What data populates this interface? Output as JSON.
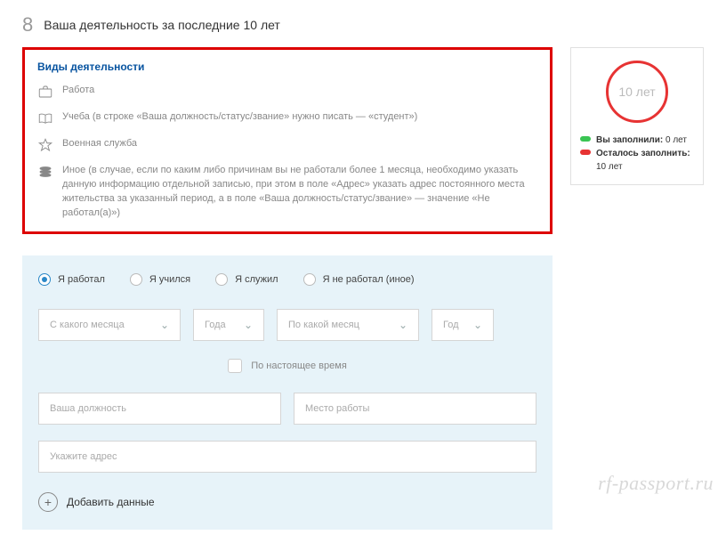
{
  "header": {
    "step": "8",
    "title": "Ваша деятельность за последние 10 лет"
  },
  "types": {
    "title": "Виды деятельности",
    "work": "Работа",
    "study": "Учеба (в строке «Ваша должность/статус/звание» нужно писать — «студент»)",
    "military": "Военная служба",
    "other": "Иное (в случае, если по каким либо причинам вы не работали более 1 месяца, необходимо указать данную информацию отдельной записью, при этом в поле «Адрес» указать адрес постоянного места жительства за указанный период, а в поле «Ваша должность/статус/звание» — значение «Не работал(а)»)"
  },
  "side": {
    "ring": "10 лет",
    "filled_label": "Вы заполнили:",
    "filled_value": "0 лет",
    "remain_label": "Осталось заполнить:",
    "remain_value": "10 лет"
  },
  "radios": {
    "worked": "Я работал",
    "studied": "Я учился",
    "served": "Я служил",
    "none": "Я не работал (иное)"
  },
  "fields": {
    "from_month": "С какого месяца",
    "year1": "Года",
    "to_month": "По какой месяц",
    "year2": "Год",
    "present": "По настоящее время",
    "position": "Ваша должность",
    "workplace": "Место работы",
    "address": "Укажите адрес"
  },
  "add_button": "Добавить данные",
  "watermark": "rf-passport.ru"
}
